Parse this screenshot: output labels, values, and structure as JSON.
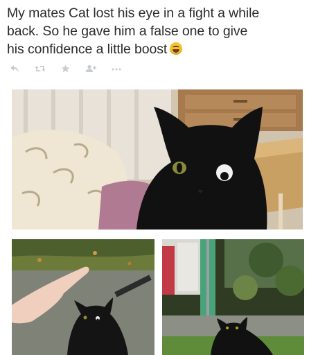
{
  "tweet": {
    "text_lines": [
      "My mates Cat lost his eye in a fight a while",
      "back. So he gave him a false one to give",
      "his confidence a little boost"
    ],
    "emoji": "face-with-tears-of-joy"
  },
  "actions": {
    "icons": [
      "reply-icon",
      "retweet-icon",
      "favorite-icon",
      "follow-icon",
      "more-icon"
    ],
    "color": "#c7ccd1"
  },
  "photos": [
    {
      "name": "photo-cat-googly-eye",
      "subject": "cat-with-googly-eye"
    },
    {
      "name": "photo-hand-cat",
      "subject": "hand-reaching-cat"
    },
    {
      "name": "photo-cat-by-post",
      "subject": "cat-by-sign-post"
    }
  ]
}
